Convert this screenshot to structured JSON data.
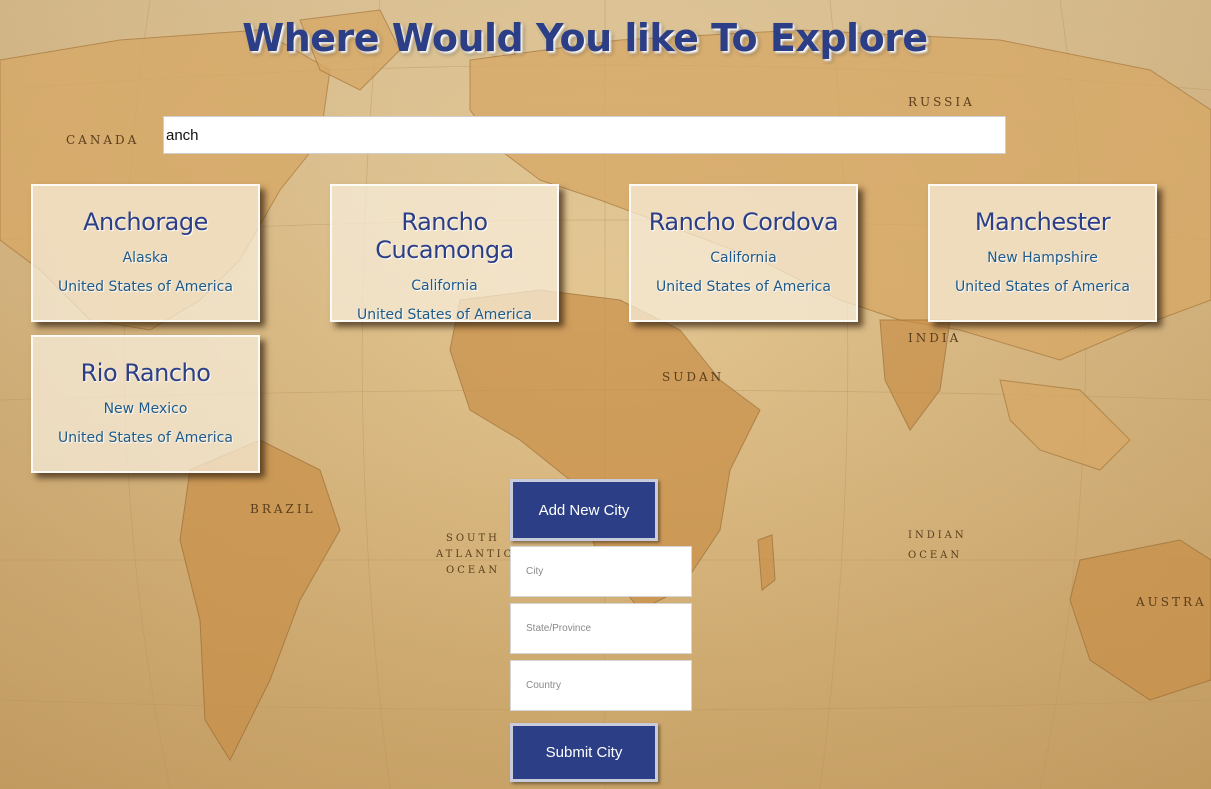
{
  "page": {
    "title": "Where Would You like To Explore"
  },
  "search": {
    "value": "anch"
  },
  "results": [
    {
      "city": "Anchorage",
      "state": "Alaska",
      "country": "United States of America"
    },
    {
      "city": "Rancho Cucamonga",
      "state": "California",
      "country": "United States of America"
    },
    {
      "city": "Rancho Cordova",
      "state": "California",
      "country": "United States of America"
    },
    {
      "city": "Manchester",
      "state": "New Hampshire",
      "country": "United States of America"
    },
    {
      "city": "Rio Rancho",
      "state": "New Mexico",
      "country": "United States of America"
    }
  ],
  "add_city": {
    "button_label": "Add New City",
    "city_placeholder": "City",
    "state_placeholder": "State/Province",
    "country_placeholder": "Country",
    "submit_label": "Submit City"
  },
  "map_labels": [
    "CANADA",
    "RUSSIA",
    "BRAZIL",
    "INDIA",
    "SUDAN",
    "ATLANTIC OCEAN",
    "INDIAN OCEAN",
    "AUSTRA"
  ],
  "colors": {
    "accent": "#2c3f86",
    "card_text": "#1d5a8a",
    "map_land": "#d7a865",
    "map_sea": "#e9d3a6"
  }
}
